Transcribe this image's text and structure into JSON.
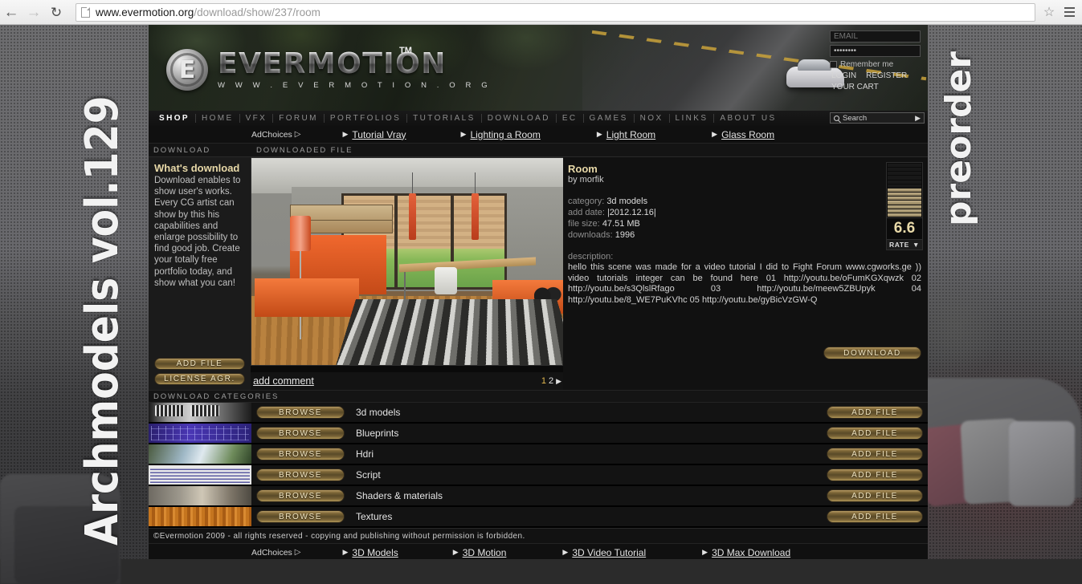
{
  "browser": {
    "back_icon": "back-arrow-icon",
    "forward_icon": "forward-arrow-icon",
    "reload_icon": "reload-icon",
    "url_domain": "www.evermotion.org",
    "url_path": "/download/show/237/room",
    "star_icon": "star-bookmark-icon",
    "menu_icon": "hamburger-menu-icon"
  },
  "banners": {
    "left": "Archmodels vol.129",
    "right": "preorder"
  },
  "masthead": {
    "logo_letter": "E",
    "logo_word": "EVERMOTION",
    "logo_sub": "W W W . E V E R M O T I O N . O R G",
    "trademark": "TM",
    "login": {
      "email_placeholder": "EMAIL",
      "email_value": "",
      "password_value": "••••••••",
      "remember_label": "Remember me",
      "login_label": "LOGIN",
      "register_label": "REGISTER",
      "cart_label": "YOUR CART"
    }
  },
  "mainnav": {
    "items": [
      "SHOP",
      "HOME",
      "VFX",
      "FORUM",
      "PORTFOLIOS",
      "TUTORIALS",
      "DOWNLOAD",
      "EC",
      "GAMES",
      "NOX",
      "LINKS",
      "ABOUT US"
    ],
    "search_placeholder": "Search",
    "search_icon": "magnifier-icon",
    "search_arrow": "▶"
  },
  "ads_top": {
    "adchoices_label": "AdChoices",
    "adchoices_icon": "adchoices-icon",
    "links": [
      "Tutorial Vray",
      "Lighting a Room",
      "Light Room",
      "Glass Room"
    ]
  },
  "columns": {
    "left_header": "DOWNLOAD",
    "center_header": "DOWNLOADED FILE"
  },
  "sidebar": {
    "title": "What's download",
    "text": "Download enables to show user's works. Every CG artist can show by this his capabilities and enlarge possibility to find good job. Create your totally free portfolio today, and show what you can!",
    "add_file_label": "ADD FILE",
    "license_label": "LICENSE AGR."
  },
  "preview": {
    "add_comment_label": "add comment",
    "page_current": "1",
    "page_next": "2",
    "page_arrow": "▶"
  },
  "file": {
    "title": "Room",
    "author": "by morfik",
    "meta": [
      {
        "label": "category:",
        "value": "3d models"
      },
      {
        "label": "add date:",
        "value": "|2012.12.16|"
      },
      {
        "label": "file size:",
        "value": "47.51 MB"
      },
      {
        "label": "downloads:",
        "value": "1996"
      }
    ],
    "description_label": "description:",
    "description": "hello this scene was made for a video tutorial I did to Fight Forum www.cgworks.ge )) video tutorials integer can be found here 01 http://youtu.be/oFumKGXqwzk 02 http://youtu.be/s3QlslRfago 03 http://youtu.be/meew5ZBUpyk 04 http://youtu.be/8_WE7PuKVhc 05 http://youtu.be/gyBicVzGW-Q",
    "download_label": "DOWNLOAD",
    "rating": {
      "score": "6.6",
      "rate_label": "RATE",
      "rate_arrow": "▼",
      "bars_total": 13,
      "bars_filled": 7
    }
  },
  "categories": {
    "header": "DOWNLOAD CATEGORIES",
    "browse_label": "BROWSE",
    "add_file_label": "ADD FILE",
    "rows": [
      {
        "name": "3d models",
        "thumb": "car-grille-thumb"
      },
      {
        "name": "Blueprints",
        "thumb": "blueprint-thumb"
      },
      {
        "name": "Hdri",
        "thumb": "hdri-sky-thumb"
      },
      {
        "name": "Script",
        "thumb": "code-script-thumb"
      },
      {
        "name": "Shaders & materials",
        "thumb": "material-swatch-thumb"
      },
      {
        "name": "Textures",
        "thumb": "wood-texture-thumb"
      }
    ]
  },
  "footer": {
    "copyright": "©Evermotion 2009 - all rights reserved - copying and publishing without permission is forbidden.",
    "adchoices_label": "AdChoices",
    "links": [
      "3D Models",
      "3D Motion",
      "3D Video Tutorial",
      "3D Max Download"
    ]
  },
  "colors": {
    "gold": "#e8d9a8",
    "accent": "#e5b94f",
    "panel": "#111111"
  }
}
